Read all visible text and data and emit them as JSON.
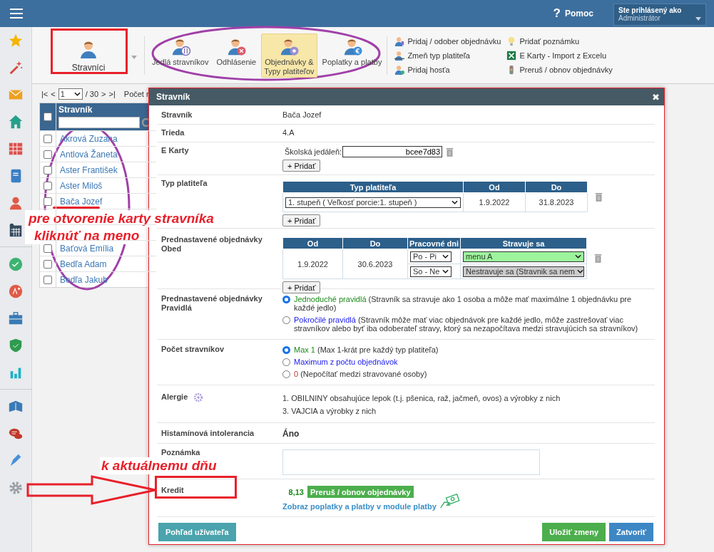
{
  "topbar": {
    "help_mark": "?",
    "help": "Pomoc",
    "user": {
      "caption": "Ste prihlásený ako",
      "value": "Administrátor"
    }
  },
  "ribbon": {
    "main": {
      "label": "Stravníci"
    },
    "tools": [
      {
        "label": "Jedlá stravníkov",
        "kind": "meals",
        "selected": false
      },
      {
        "label": "Odhlásenie",
        "kind": "logout",
        "selected": false
      },
      {
        "label": "Objednávky &\nTypy platiteľov",
        "kind": "orders",
        "selected": true
      },
      {
        "label": "Poplatky a platby",
        "kind": "payments",
        "selected": false
      }
    ],
    "actions": [
      {
        "label": "Pridaj / odober objednávku",
        "kind": "person-edit"
      },
      {
        "label": "Zmeň typ platiteľa",
        "kind": "person-swap"
      },
      {
        "label": "Pridaj hosťa",
        "kind": "person-add"
      },
      {
        "label": "Pridať poznámku",
        "kind": "bulb"
      },
      {
        "label": "E Karty - Import z Excelu",
        "kind": "excel"
      },
      {
        "label": "Preruš / obnov objednávky",
        "kind": "traffic"
      }
    ]
  },
  "pager": {
    "first": "|<",
    "prev": "<",
    "page": "1",
    "total": "/ 30",
    "next": ">",
    "last": ">|",
    "count_label": "Počet r"
  },
  "list": {
    "column": "Stravník",
    "header_checked": false,
    "rows": [
      {
        "kind": "diner",
        "name": "Akrová Zuzana",
        "checked": false
      },
      {
        "kind": "diner",
        "name": "Antlová Žaneta",
        "checked": false
      },
      {
        "kind": "diner",
        "name": "Aster František",
        "checked": false
      },
      {
        "kind": "diner",
        "name": "Aster Miloš",
        "checked": false
      },
      {
        "kind": "diner",
        "name": "Bača Jozef",
        "checked": false
      },
      {
        "kind": "covered"
      },
      {
        "kind": "covered"
      },
      {
        "kind": "diner",
        "name": "Baťová Emília",
        "checked": false
      },
      {
        "kind": "diner",
        "name": "Bedľa Adam",
        "checked": false
      },
      {
        "kind": "diner",
        "name": "Bedľa Jakub",
        "checked": false
      }
    ]
  },
  "modal": {
    "title": "Stravník",
    "close": "✖",
    "rows": [
      {
        "kind": "text",
        "label": "Stravník",
        "value": "Bača Jozef"
      },
      {
        "kind": "text",
        "label": "Trieda",
        "value": "4.A"
      },
      {
        "kind": "ecards",
        "label": "E Karty",
        "cards": [
          {
            "label": "Školská jedáleň:",
            "value": "bcee7d83"
          }
        ],
        "add": "+ Pridať"
      },
      {
        "kind": "payer",
        "label": "Typ platiteľa",
        "columns": [
          "Typ platiteľa",
          "Od",
          "Do"
        ],
        "rows": [
          {
            "type": "1. stupeň ( Veľkosť porcie:1. stupeň )",
            "from": "1.9.2022",
            "to": "31.8.2023"
          }
        ],
        "add": "+ Pridať"
      },
      {
        "kind": "orders",
        "label": "Prednastavené objednávky\nObed",
        "columns": [
          "Od",
          "Do",
          "Pracovné dni",
          "Stravuje sa"
        ],
        "from": "1.9.2022",
        "to": "30.6.2023",
        "days": [
          {
            "days": "Po - Pi",
            "meal": "menu A",
            "eats": true
          },
          {
            "days": "So - Ne",
            "meal": "Nestravuje sa (Stravnik sa nem",
            "eats": false
          }
        ],
        "add": "+ Pridať"
      },
      {
        "kind": "radios",
        "label": "Prednastavené objednávky\nPravidlá",
        "options": [
          {
            "title": "Jednoduché pravidlá",
            "note": "(Stravník sa stravuje ako 1 osoba a môže mať maximálne 1 objednávku pre každé jedlo)",
            "kind": "basic",
            "selected": true
          },
          {
            "title": "Pokročilé pravidlá",
            "note": "(Stravník môže mať viac objednávok pre každé jedlo, môže zastrešovať viac stravníkov alebo byť iba odoberateľ stravy, ktorý sa nezapočítava medzi stravujúcich sa stravníkov)",
            "kind": "extended",
            "selected": false
          }
        ]
      },
      {
        "kind": "radios",
        "label": "Počet stravníkov",
        "options": [
          {
            "title": "Max 1",
            "note": "(Max 1-krát pre každý typ platiteľa)",
            "kind": "basic",
            "selected": true
          },
          {
            "title": "Maximum z počtu objednávok",
            "kind": "extended",
            "selected": false
          },
          {
            "title": "0",
            "note": "(Nepočítať medzi stravované osoby)",
            "kind": "excluded",
            "selected": false
          }
        ]
      },
      {
        "kind": "allergies",
        "label": "Alergie",
        "items": [
          "1. OBILNINY obsahujúce lepok (t.j. pšenica, raž, jačmeň, ovos) a výrobky z nich",
          "3. VAJCIA a výrobky z nich"
        ]
      },
      {
        "kind": "flag",
        "label": "Histamínová intolerancia",
        "value": "Áno"
      },
      {
        "kind": "note",
        "label": "Poznámka"
      },
      {
        "kind": "credit",
        "label": "Kredit",
        "amount": "8,13",
        "button": "Preruš / obnov objednávky",
        "link": "Zobraz poplatky a platby v module platby"
      }
    ],
    "footer": {
      "left": "Pohľad užívateľa",
      "save": "Uložiť zmeny",
      "close": "Zatvoriť"
    }
  },
  "annotations": {
    "hint_lines": [
      "pre otvorenie karty stravníka",
      "kliknúť na meno"
    ],
    "date_note": "k aktuálnemu dňu"
  }
}
